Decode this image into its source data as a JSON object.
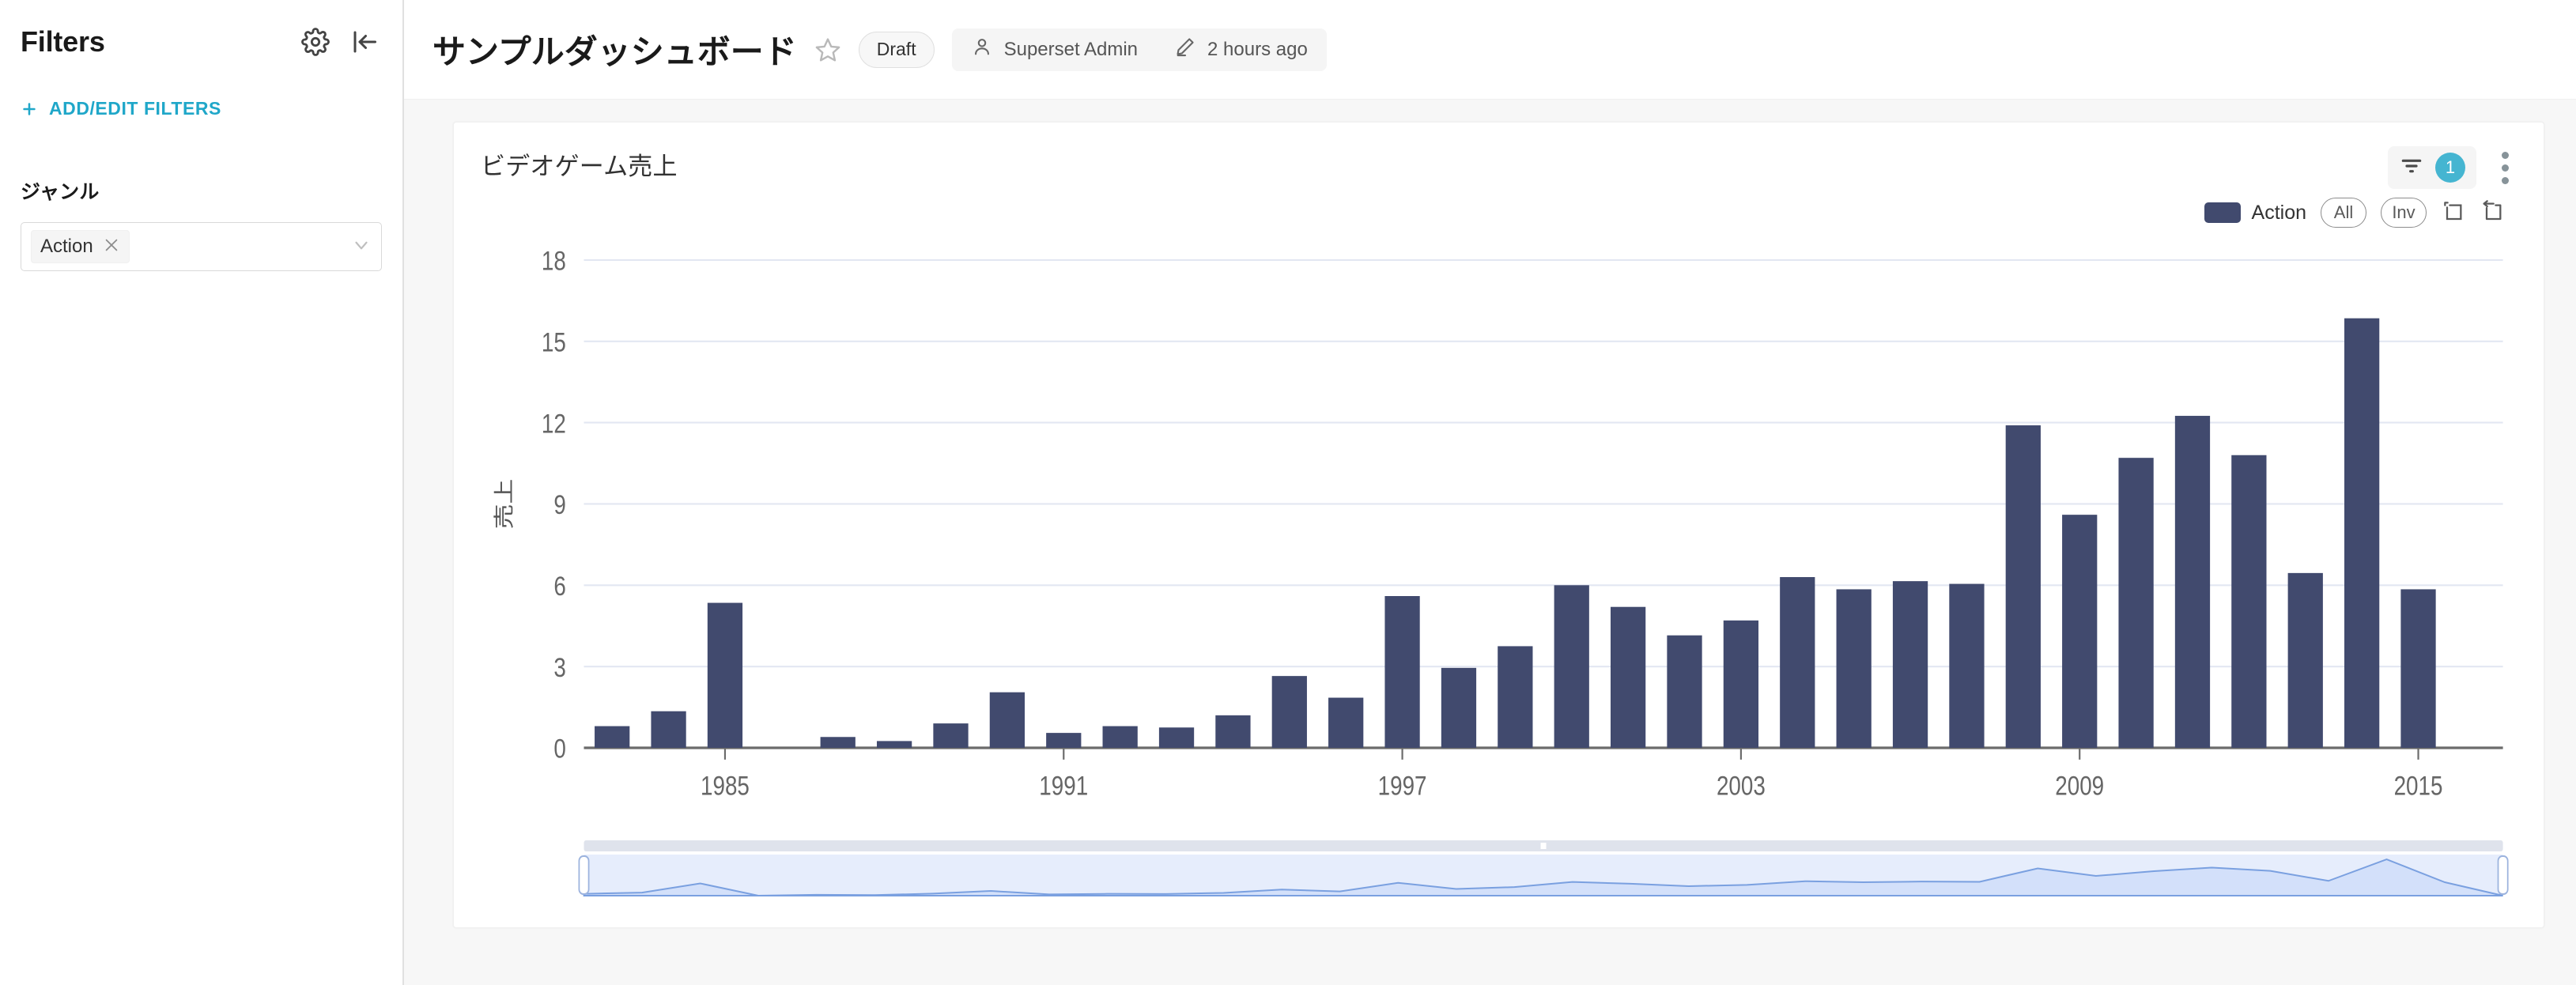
{
  "sidebar": {
    "title": "Filters",
    "gear_icon": "gear-icon",
    "collapse_icon": "collapse-left-icon",
    "add_edit_filters": "ADD/EDIT FILTERS",
    "plus_icon": "plus-icon",
    "filter_group_label": "ジャンル",
    "selected_tag": "Action",
    "remove_tag_icon": "close-icon",
    "chevron_icon": "chevron-down-icon"
  },
  "header": {
    "title": "サンプルダッシュボード",
    "star_icon": "star-outline-icon",
    "status_badge": "Draft",
    "owner_icon": "user-icon",
    "owner": "Superset Admin",
    "edited_icon": "pencil-icon",
    "last_modified": "2 hours ago"
  },
  "chart": {
    "title": "ビデオゲーム売上",
    "filter_icon": "filter-icon",
    "filter_count": "1",
    "menu_icon": "kebab-menu-icon",
    "legend_series": "Action",
    "legend_all": "All",
    "legend_inv": "Inv",
    "zoom_select_icon": "zoom-select-icon",
    "zoom_reset_icon": "zoom-reset-icon",
    "series_color": "#414a6e",
    "gridline_color": "#e3e7f2",
    "axis_color": "#6b6b6b",
    "slider_fill": "#e3ebfb",
    "slider_line": "#7aa0e0"
  },
  "chart_data": {
    "type": "bar",
    "title": "ビデオゲーム売上",
    "xlabel": "",
    "ylabel": "売上",
    "ylim": [
      0,
      18
    ],
    "yticks": [
      0,
      3,
      6,
      9,
      12,
      15,
      18
    ],
    "xticks": [
      "1985",
      "1991",
      "1997",
      "2003",
      "2009",
      "2015"
    ],
    "grid": true,
    "legend_position": "top-right",
    "categories": [
      "1983",
      "1984",
      "1985",
      "1986",
      "1987",
      "1988",
      "1989",
      "1990",
      "1991",
      "1992",
      "1993",
      "1994",
      "1995",
      "1996",
      "1997",
      "1998",
      "1999",
      "2000",
      "2001",
      "2002",
      "2003",
      "2004",
      "2005",
      "2006",
      "2007",
      "2008",
      "2009",
      "2010",
      "2011",
      "2012",
      "2013",
      "2014",
      "2015",
      "2016"
    ],
    "series": [
      {
        "name": "Action",
        "color": "#414a6e",
        "values": [
          0.8,
          1.35,
          5.35,
          0.0,
          0.4,
          0.25,
          0.9,
          2.05,
          0.55,
          0.8,
          0.75,
          1.2,
          2.65,
          1.85,
          5.6,
          2.95,
          3.75,
          6.0,
          5.2,
          4.15,
          4.7,
          6.3,
          5.85,
          6.15,
          6.05,
          11.9,
          8.6,
          10.7,
          12.25,
          10.8,
          6.45,
          15.85,
          5.85,
          0.0
        ]
      }
    ]
  }
}
